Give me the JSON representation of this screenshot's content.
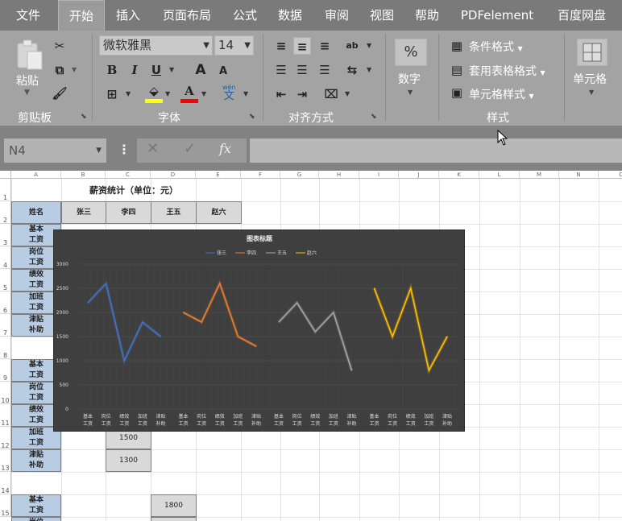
{
  "menu": {
    "tabs": [
      "文件",
      "开始",
      "插入",
      "页面布局",
      "公式",
      "数据",
      "审阅",
      "视图",
      "帮助",
      "PDFelement",
      "百度网盘"
    ],
    "active": "开始"
  },
  "ribbon": {
    "clipboard": {
      "paste_label": "粘贴",
      "group_label": "剪贴板"
    },
    "font": {
      "font_name": "微软雅黑",
      "font_size": "14",
      "bold": "B",
      "italic": "I",
      "underline": "U",
      "grow": "A",
      "shrink": "A",
      "phonetic_top": "wén",
      "phonetic_bottom": "文",
      "group_label": "字体",
      "fill_color": "#ffff00",
      "font_color": "#ff0000"
    },
    "alignment": {
      "group_label": "对齐方式"
    },
    "number": {
      "percent": "%",
      "label": "数字"
    },
    "styles": {
      "conditional": "条件格式",
      "table_format": "套用表格格式",
      "cell_style": "单元格样式",
      "group_label": "样式"
    },
    "cells": {
      "label": "单元格"
    }
  },
  "formula_bar": {
    "name_box": "N4",
    "formula": ""
  },
  "columns": [
    "A",
    "B",
    "C",
    "D",
    "E",
    "F",
    "G",
    "H",
    "I",
    "J",
    "K",
    "L",
    "M",
    "N",
    "O"
  ],
  "rows": [
    "1",
    "2",
    "3",
    "4",
    "5",
    "6",
    "7",
    "8",
    "9",
    "10",
    "11",
    "12",
    "13",
    "14",
    "15"
  ],
  "sheet": {
    "title": "薪资统计（单位：元）",
    "name_header": "姓名",
    "people": [
      "张三",
      "李四",
      "王五",
      "赵六"
    ],
    "items": [
      "基本\n工资",
      "岗位\n工资",
      "绩效\n工资",
      "加班\n工资",
      "津贴\n补助"
    ],
    "c12": "1500",
    "c13": "1300",
    "d15": "1800"
  },
  "chart_data": {
    "type": "line",
    "title": "图表标题",
    "categories": [
      "基本\n工资",
      "岗位\n工资",
      "绩效\n工资",
      "加班\n工资",
      "津贴\n补助"
    ],
    "yticks": [
      "3000",
      "2500",
      "2000",
      "1500",
      "1000",
      "500",
      "0"
    ],
    "ylim": [
      0,
      3000
    ],
    "grid": true,
    "legend_position": "top",
    "series": [
      {
        "name": "张三",
        "color": "#4472c4",
        "values": [
          2200,
          2600,
          1000,
          1800,
          1500
        ]
      },
      {
        "name": "李四",
        "color": "#ed7d31",
        "values": [
          2000,
          1800,
          2600,
          1500,
          1300
        ]
      },
      {
        "name": "王五",
        "color": "#a5a5a5",
        "values": [
          1800,
          2200,
          1600,
          2000,
          800
        ]
      },
      {
        "name": "赵六",
        "color": "#ffc000",
        "values": [
          2500,
          1500,
          2500,
          800,
          1500
        ]
      }
    ]
  }
}
